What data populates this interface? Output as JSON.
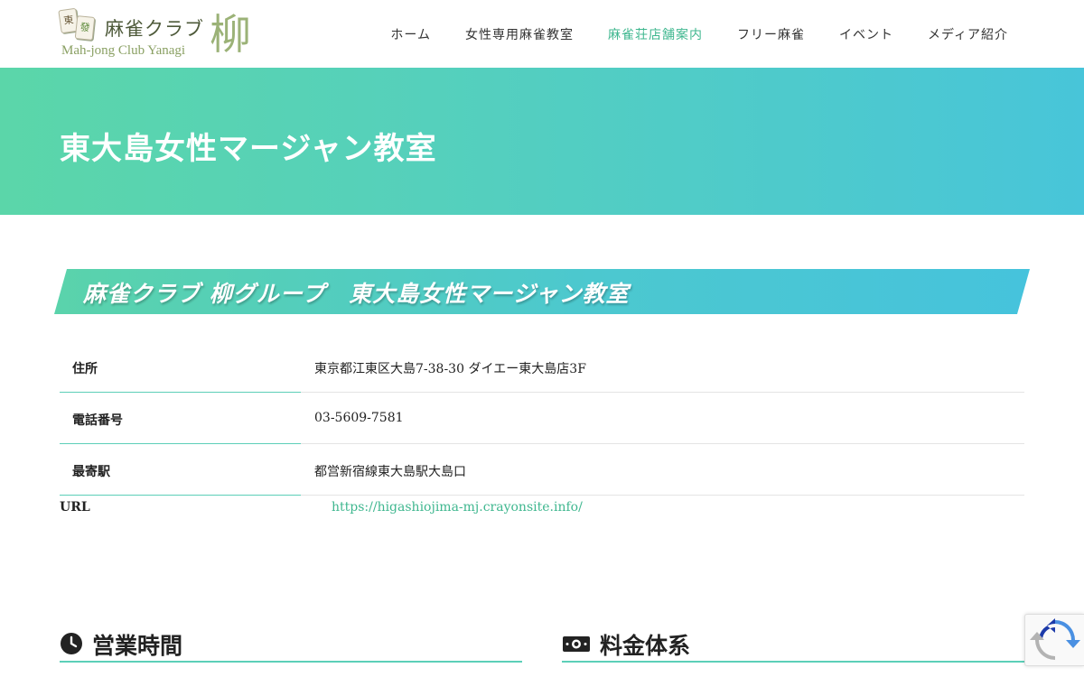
{
  "header": {
    "logo": {
      "tile1": "東",
      "tile2": "發",
      "title_jp": "麻雀クラブ",
      "title_en": "Mah-jong Club Yanagi",
      "kanji": "柳"
    },
    "nav": [
      {
        "label": "ホーム",
        "active": false
      },
      {
        "label": "女性専用麻雀教室",
        "active": false
      },
      {
        "label": "麻雀荘店舗案内",
        "active": true
      },
      {
        "label": "フリー麻雀",
        "active": false
      },
      {
        "label": "イベント",
        "active": false
      },
      {
        "label": "メディア紹介",
        "active": false
      }
    ]
  },
  "hero": {
    "title": "東大島女性マージャン教室"
  },
  "banner": {
    "text": "麻雀クラブ 柳グループ　東大島女性マージャン教室"
  },
  "info": {
    "rows": [
      {
        "label": "住所",
        "value": "東京都江東区大島7-38-30 ダイエー東大島店3F"
      },
      {
        "label": "電話番号",
        "value": "03-5609-7581"
      },
      {
        "label": "最寄駅",
        "value": "都営新宿線東大島駅大島口"
      }
    ],
    "url": {
      "label": "URL",
      "value": "https://higashiojima-mj.crayonsite.info/"
    }
  },
  "sections": {
    "hours": {
      "title": "営業時間",
      "icon": "clock-icon"
    },
    "pricing": {
      "title": "料金体系",
      "icon": "money-icon"
    }
  },
  "colors": {
    "accent": "#3fb78f",
    "gradient_start": "#5bd6a9",
    "gradient_end": "#48c5d9"
  }
}
